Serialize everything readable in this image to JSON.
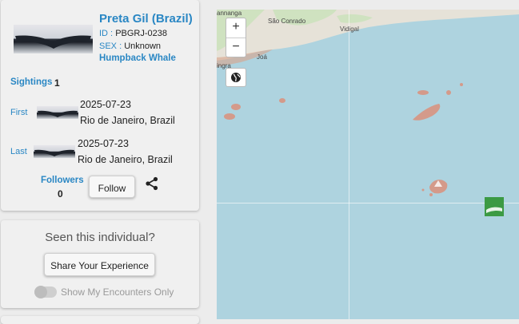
{
  "individual": {
    "name": "Preta Gil (Brazil)",
    "id_label": "ID :",
    "id_value": "PBGRJ-0238",
    "sex_label": "SEX :",
    "sex_value": "Unknown",
    "species": "Humpback Whale"
  },
  "sightings": {
    "label": "Sightings",
    "count": "1"
  },
  "first": {
    "label": "First",
    "date": "2025-07-23",
    "location": "Rio de Janeiro, Brazil"
  },
  "last": {
    "label": "Last",
    "date": "2025-07-23",
    "location": "Rio de Janeiro, Brazil"
  },
  "followers": {
    "label": "Followers",
    "count": "0",
    "button": "Follow"
  },
  "seen": {
    "title": "Seen this individual?",
    "share_button": "Share Your Experience",
    "toggle_label": "Show My Encounters Only",
    "toggle_on": false
  },
  "map": {
    "zoom_in": "+",
    "zoom_out": "−",
    "labels": {
      "sao_conrado": "São Conrado",
      "vidigal": "Vidigal",
      "joa": "Joá",
      "ananga": "annanga",
      "ingra": "ingra"
    },
    "water_color": "#aed3df",
    "land_color": "#e6e2d8",
    "marker_color": "#3c9a44"
  },
  "icons": {
    "share": "share-icon",
    "globe": "globe-icon",
    "marker": "photo-marker-icon"
  }
}
